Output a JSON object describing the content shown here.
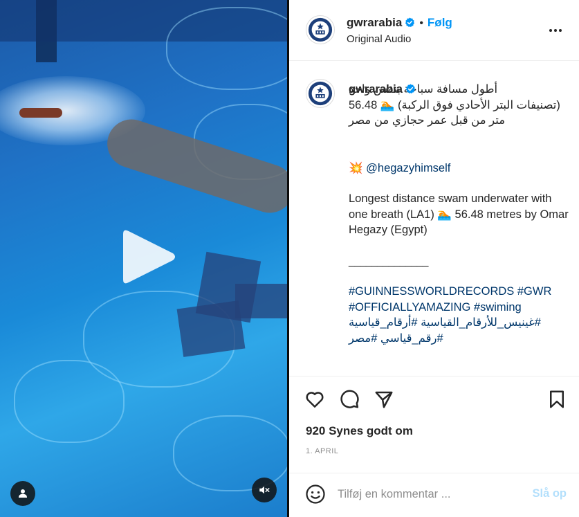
{
  "post": {
    "username": "gwrarabia",
    "follow_label": "Følg",
    "separator": "•",
    "audio_label": "Original Audio"
  },
  "caption": {
    "username": "gwrarabia",
    "arabic_line": "أطول مسافة سباحة بنفس واحد (تصنيفات البتر الأحادي فوق الركبة) 🏊 56.48 متر من قبل عمر حجازي من مصر",
    "mention_emoji": "💥",
    "mention": "@hegazyhimself",
    "english": "Longest distance swam underwater with one breath (LA1) 🏊 56.48 metres by Omar Hegazy (Egypt)",
    "rule": "______________",
    "hashtags_line1": "#GUINNESSWORLDRECORDS #GWR",
    "hashtags_line2": "#OFFICIALLYAMAZING #swiming",
    "hashtags_line3": "#غينيس_للأرقام_القياسية #أرقام_قياسية",
    "hashtags_line4": "#رقم_قياسي #مصر"
  },
  "stats": {
    "likes": "920 Synes godt om",
    "date": "1. APRIL"
  },
  "comment": {
    "placeholder": "Tilføj en kommentar ...",
    "post_label": "Slå op"
  },
  "icons": {
    "more": "more-dots-icon",
    "like": "heart-icon",
    "comment": "comment-bubble-icon",
    "share": "paper-plane-icon",
    "save": "bookmark-icon",
    "emoji": "smiley-icon",
    "play": "play-icon",
    "user": "user-tag-icon",
    "mute": "muted-speaker-icon",
    "verified": "verified-badge-icon"
  },
  "colors": {
    "accent": "#0095f6",
    "link": "#00376b",
    "verified": "#0095f6",
    "post_disabled": "#b2dffc"
  }
}
